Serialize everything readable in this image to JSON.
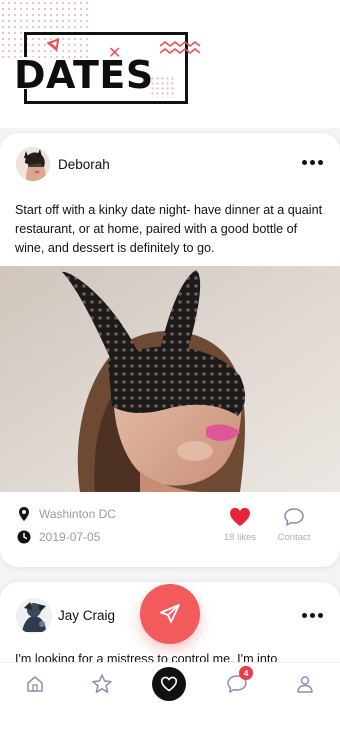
{
  "header": {
    "title": "DATES"
  },
  "posts": [
    {
      "author": "Deborah",
      "text": "Start off with a kinky date night- have dinner at a quaint restaurant, or at home, paired with a good bottle of wine, and dessert is definitely to go.",
      "location": "Washinton DC",
      "date": "2019-07-05",
      "likes": "18 likes",
      "contact_label": "Contact"
    },
    {
      "author": "Jay Craig",
      "text": "I'm looking for a mistress to control me. I'm into"
    }
  ],
  "tabbar": {
    "chat_badge": "4"
  },
  "colors": {
    "accent": "#f35a5c",
    "like": "#e8243b",
    "muted": "#9a9aa3",
    "dark": "#111111"
  },
  "icons": {
    "tabs": [
      "home-icon",
      "star-icon",
      "heart-icon",
      "chat-icon",
      "profile-icon"
    ],
    "fab": "send-icon",
    "meta": [
      "location-pin-icon",
      "clock-icon"
    ]
  }
}
